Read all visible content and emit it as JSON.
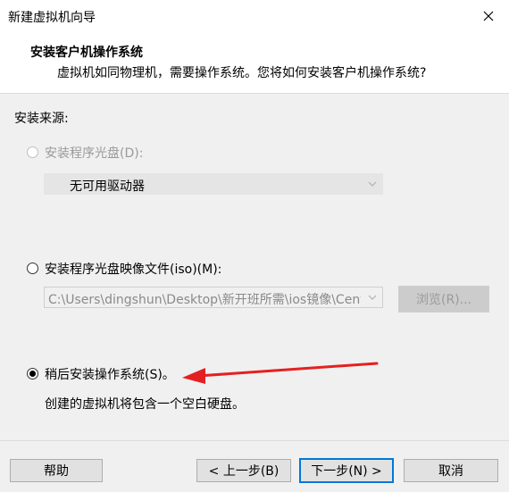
{
  "window": {
    "title": "新建虚拟机向导"
  },
  "header": {
    "title": "安装客户机操作系统",
    "subtitle": "虚拟机如同物理机，需要操作系统。您将如何安装客户机操作系统?"
  },
  "install_source": {
    "label": "安装来源:",
    "options": [
      {
        "label": "安装程序光盘(D):",
        "selected": false,
        "enabled": false
      },
      {
        "label": "安装程序光盘映像文件(iso)(M):",
        "selected": false,
        "enabled": true
      },
      {
        "label": "稍后安装操作系统(S)。",
        "selected": true,
        "enabled": true
      }
    ],
    "drive_select_value": "无可用驱动器",
    "iso_path_value": "C:\\Users\\dingshun\\Desktop\\新开班所需\\ios镜像\\Cent",
    "browse_label": "浏览(R)...",
    "later_description": "创建的虚拟机将包含一个空白硬盘。"
  },
  "footer": {
    "help_label": "帮助",
    "back_label": "< 上一步(B)",
    "next_label": "下一步(N) >",
    "cancel_label": "取消"
  },
  "colors": {
    "annotation_arrow": "#e52020",
    "primary_focus": "#0078d7"
  }
}
